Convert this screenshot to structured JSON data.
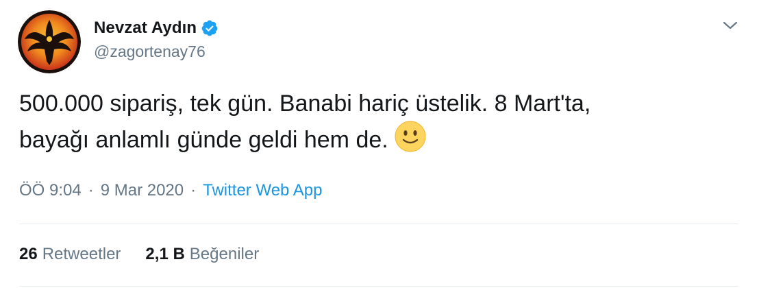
{
  "author": {
    "display_name": "Nevzat Aydın",
    "handle": "@zagortenay76",
    "verified": true
  },
  "tweet": {
    "text": "500.000 sipariş, tek gün. Banabi hariç üstelik. 8 Mart'ta,\nbayağı anlamlı günde geldi hem de.",
    "emoji": "slightly-smiling-face-icon"
  },
  "meta": {
    "time": "ÖÖ 9:04",
    "separator_1": "·",
    "date": "9 Mar 2020",
    "separator_2": "·",
    "source": "Twitter Web App"
  },
  "stats": {
    "retweets_count": "26",
    "retweets_label": "Retweetler",
    "likes_count": "2,1 B",
    "likes_label": "Beğeniler"
  },
  "colors": {
    "text_primary": "#14171a",
    "text_secondary": "#657786",
    "link": "#1b95e0",
    "verified": "#1da1f2",
    "divider": "#e6ecf0",
    "avatar_bg": "#d9471c"
  },
  "icons": {
    "verified": "verified-badge-icon",
    "caret": "chevron-down-icon",
    "avatar": "phoenix-logo"
  }
}
